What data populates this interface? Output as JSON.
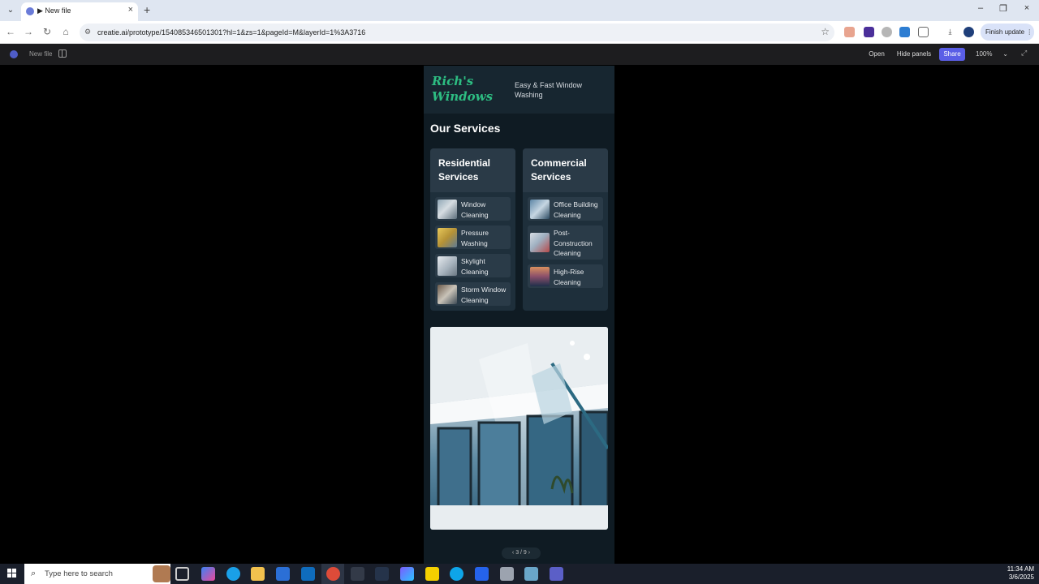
{
  "browser": {
    "tab_title": "New file",
    "url": "creatie.ai/prototype/154085346501301?hl=1&zs=1&pageId=M&layerId=1%3A3716",
    "finish_update": "Finish update"
  },
  "app": {
    "file_name": "New file",
    "open_label": "Open",
    "hide_panels_label": "Hide panels",
    "share_label": "Share",
    "zoom": "100%"
  },
  "prototype": {
    "logo": "Rich's Windows",
    "tagline": "Easy & Fast Window Washing",
    "section_title": "Our Services",
    "residential": {
      "title": "Residential Services",
      "items": [
        {
          "label": "Window Cleaning"
        },
        {
          "label": "Pressure Washing"
        },
        {
          "label": "Skylight Cleaning"
        },
        {
          "label": "Storm Window Cleaning"
        }
      ]
    },
    "commercial": {
      "title": "Commercial Services",
      "items": [
        {
          "label": "Office Building Cleaning"
        },
        {
          "label": "Post-Construction Cleaning"
        },
        {
          "label": "High-Rise Cleaning"
        }
      ]
    },
    "pager": "3 / 9"
  },
  "taskbar": {
    "search_placeholder": "Type here to search",
    "time": "11:34 AM",
    "date": "3/6/2025"
  }
}
